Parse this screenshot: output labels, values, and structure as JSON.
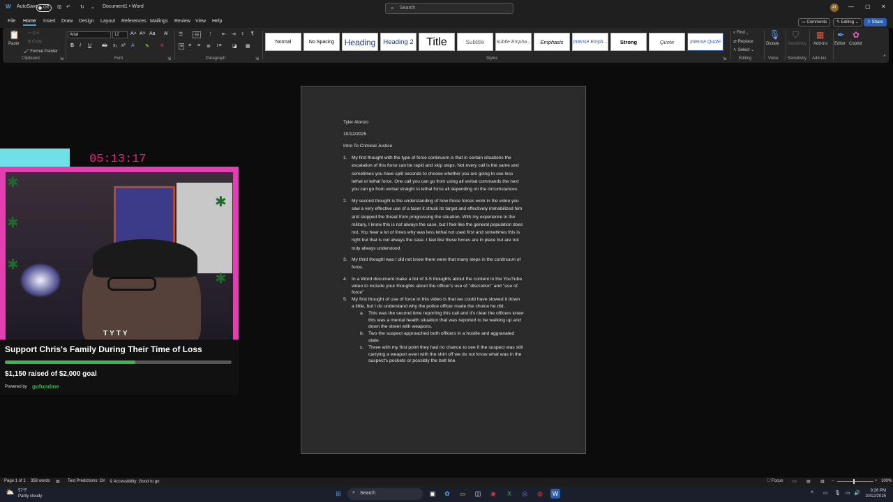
{
  "titlebar": {
    "autosave": "AutoSave",
    "autosave_state": "Off",
    "doc_title": "Document1 • Word",
    "search_placeholder": "Search",
    "avatar_initials": "AT"
  },
  "menu": {
    "items": [
      "File",
      "Home",
      "Insert",
      "Draw",
      "Design",
      "Layout",
      "References",
      "Mailings",
      "Review",
      "View",
      "Help"
    ],
    "active": "Home",
    "comments": "Comments",
    "editing": "Editing",
    "share": "Share"
  },
  "ribbon": {
    "paste": "Paste",
    "cut": "Cut",
    "copy": "Copy",
    "format_painter": "Format Painter",
    "clipboard": "Clipboard",
    "font_name": "Arial",
    "font_size": "12",
    "font": "Font",
    "paragraph": "Paragraph",
    "styles_label": "Styles",
    "styles": [
      "Normal",
      "No Spacing",
      "Heading",
      "Heading 2",
      "Title",
      "Subtitle",
      "Subtle Empha...",
      "Emphasis",
      "Intense Emph...",
      "Strong",
      "Quote",
      "Intense Quote"
    ],
    "find": "Find",
    "replace": "Replace",
    "select": "Select",
    "editing_group": "Editing",
    "dictate": "Dictate",
    "voice": "Voice",
    "sensitivity": "Sensitivity",
    "addins": "Add-ins",
    "editor": "Editor",
    "copilot": "Copilot"
  },
  "document": {
    "name": "Tyler Alonzo",
    "date": "10/12/2025",
    "course": "Intro To Criminal Justice",
    "items": [
      {
        "num": "1.",
        "lines": [
          "My first thought with the type of force continuum is that in certain situations the",
          "escalation of this force can be rapid and skip steps. Not every call is the same and",
          "sometimes you have split seconds to choose whether you are going to use less",
          "lethal or lethal force. One call you can go from using all verbal commands the next",
          "you can go from verbal straight to lethal force all depending on the circumstances."
        ]
      },
      {
        "num": "2.",
        "lines": [
          "My second thought is the understanding of how these forces work in the video you",
          "saw a very effective use of a taser it struck its target and effectively immobilized him",
          "and stopped the threat from progressing the situation. With my experience in the",
          "military, I know this is not always the case, but I feel like the general population does",
          "not. You hear a lot of times why was less lethal not used first and sometimes this is",
          "right but that is not always the case. I feel like these forces are in place but are not",
          "truly always understood."
        ]
      },
      {
        "num": "3.",
        "lines": [
          "My third thought was I did not know there were that many steps in the continuum of",
          "force."
        ]
      },
      {
        "num": "4.",
        "lines": [
          "In a Word document make a list of 3-5 thoughts about the content in the YouTube",
          "video to include your thoughts about the officer's use of \"discretion\" and \"use of",
          "force\""
        ]
      },
      {
        "num": "5.",
        "lines": [
          "My first thought of use of force in this video is that we could have slowed it down",
          "a little, but I do understand why the police officer made the choice he did."
        ]
      }
    ],
    "subitems": [
      {
        "num": "a.",
        "lines": [
          "This was the second time reporting this call and it's clear the officers knew",
          "this was a mental health situation that was reported to be walking up and",
          "down the street with weapons."
        ]
      },
      {
        "num": "b.",
        "lines": [
          "Two the suspect approached both officers in a hostile and aggravated",
          "state."
        ]
      },
      {
        "num": "c.",
        "lines": [
          "Three with my first point they had no chance to see if the suspect was still",
          "carrying a weapon even with the shirt off we do not know what was in the",
          "suspect's pockets or possibly the belt line."
        ]
      }
    ]
  },
  "stream": {
    "timer": "05:13:17",
    "donation_title": "Support Chris's Family During Their Time of Loss",
    "progress": 0.575,
    "amount": "$1,150 raised of $2,000 goal",
    "powered_by": "Powered by",
    "brand": "gofundme",
    "cam_text": "TYTY"
  },
  "status": {
    "page": "Page 1 of 1",
    "words": "358 words",
    "text_predictions": "Text Predictions: On",
    "accessibility": "Accessibility: Good to go",
    "focus": "Focus",
    "zoom": "100%"
  },
  "taskbar": {
    "temp": "57°F",
    "weather": "Partly cloudy",
    "search": "Search",
    "time": "9:26 PM",
    "date": "10/12/2025"
  },
  "colors": {
    "accent": "#5b9bd5",
    "share": "#2d5fab",
    "timer": "#e6207a",
    "frame": "#e23fb0",
    "progress": "#3cb554"
  }
}
